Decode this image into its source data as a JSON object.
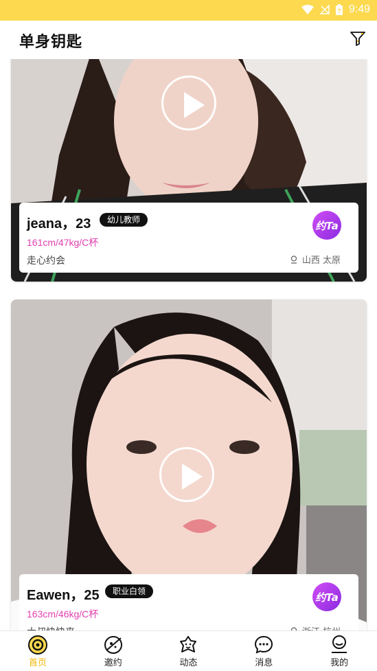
{
  "status_bar": {
    "time": "9:49"
  },
  "app": {
    "title": "单身钥匙"
  },
  "cards": [
    {
      "name_age": "jeana，23",
      "tag": "幼儿教师",
      "stats": "161cm/47kg/C杯",
      "desc": "走心约会",
      "location": "山西 太原",
      "action": "约Ta"
    },
    {
      "name_age": "Eawen，25",
      "tag": "职业白领",
      "stats": "163cm/46kg/C杯",
      "desc": "大叔快快来",
      "location": "浙江 杭州",
      "action": "约Ta"
    }
  ],
  "tabs": [
    {
      "label": "首页",
      "icon": "home-icon",
      "active": true
    },
    {
      "label": "邀约",
      "icon": "planet-icon",
      "active": false
    },
    {
      "label": "动态",
      "icon": "moments-icon",
      "active": false
    },
    {
      "label": "消息",
      "icon": "message-icon",
      "active": false
    },
    {
      "label": "我的",
      "icon": "profile-icon",
      "active": false
    }
  ],
  "colors": {
    "accent": "#fcd94f",
    "active_tab": "#f2b705",
    "stats_pink": "#e23fb0",
    "yue_purple": "#b23ce8"
  }
}
